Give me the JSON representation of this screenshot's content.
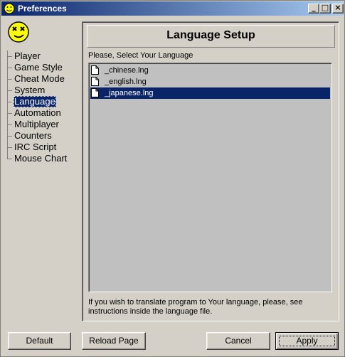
{
  "window": {
    "title": "Preferences",
    "buttons": {
      "minimize": "_",
      "maximize": "□",
      "close": "×"
    }
  },
  "sidebar": {
    "items": [
      {
        "label": "Player"
      },
      {
        "label": "Game Style"
      },
      {
        "label": "Cheat Mode"
      },
      {
        "label": "System"
      },
      {
        "label": "Language",
        "selected": true
      },
      {
        "label": "Automation"
      },
      {
        "label": "Multiplayer"
      },
      {
        "label": "Counters"
      },
      {
        "label": "IRC Script"
      },
      {
        "label": "Mouse Chart"
      }
    ]
  },
  "panel": {
    "heading": "Language Setup",
    "prompt": "Please, Select Your Language",
    "files": [
      {
        "name": "_chinese.lng"
      },
      {
        "name": "_english.lng"
      },
      {
        "name": "_japanese.lng",
        "selected": true
      }
    ],
    "note": "If you wish to translate program to Your language, please, see instructions inside the language file."
  },
  "buttons": {
    "default": "Default",
    "reload": "Reload Page",
    "cancel": "Cancel",
    "apply": "Apply"
  },
  "colors": {
    "title_start": "#0a246a",
    "title_end": "#a6caf0",
    "selection": "#0a246a",
    "face": "#d4d0c8",
    "list_bg": "#c0c0c0",
    "logo": "#ffff00"
  }
}
